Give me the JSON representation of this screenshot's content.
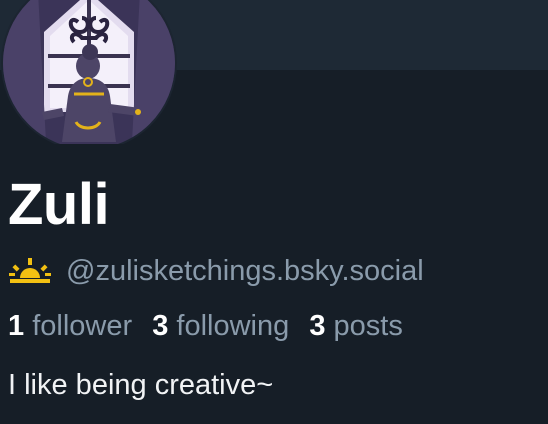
{
  "profile": {
    "display_name": "Zuli",
    "handle": "@zulisketchings.bsky.social",
    "handle_icon": "sunrise-emoji-icon",
    "bio": "I like being creative~"
  },
  "stats": {
    "followers_count": "1",
    "followers_label": "follower",
    "following_count": "3",
    "following_label": "following",
    "posts_count": "3",
    "posts_label": "posts"
  },
  "colors": {
    "page_background": "#161e27",
    "banner": "#1e2935",
    "muted_text": "#8a9bab",
    "text": "#ffffff",
    "sun": "#f2c012"
  }
}
